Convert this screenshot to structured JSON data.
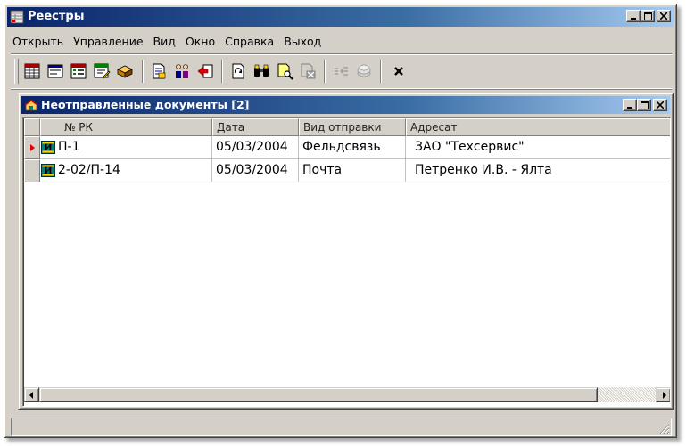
{
  "window": {
    "title": "Реестры"
  },
  "menu": [
    "Открыть",
    "Управление",
    "Вид",
    "Окно",
    "Справка",
    "Выход"
  ],
  "toolbar_icons": [
    "register-grid-icon",
    "form-icon",
    "register-list-icon",
    "register-edit-icon",
    "package-icon",
    "document-icon",
    "users-icon",
    "send-red-icon",
    "document-refresh-icon",
    "binoculars-icon",
    "document-search-icon",
    "document-disabled-icon",
    "list-disabled-icon",
    "stack-disabled-icon",
    "close-x-icon"
  ],
  "child_window": {
    "title": "Неотправленные документы [2]"
  },
  "table": {
    "columns": [
      "№ РК",
      "Дата",
      "Вид отправки",
      "Адресат"
    ],
    "rows": [
      {
        "badge": "И",
        "rk": "П-1",
        "date": "05/03/2004",
        "send_type": "Фельдсвязь",
        "addressee": "ЗАО \"Техсервис\""
      },
      {
        "badge": "И",
        "rk": "2-02/П-14",
        "date": "05/03/2004",
        "send_type": "Почта",
        "addressee": "Петренко И.В. - Ялта"
      }
    ]
  },
  "colors": {
    "title_start": "#0a246a",
    "title_end": "#a6caf0",
    "face": "#d4d0c8",
    "badge": "#008080"
  }
}
